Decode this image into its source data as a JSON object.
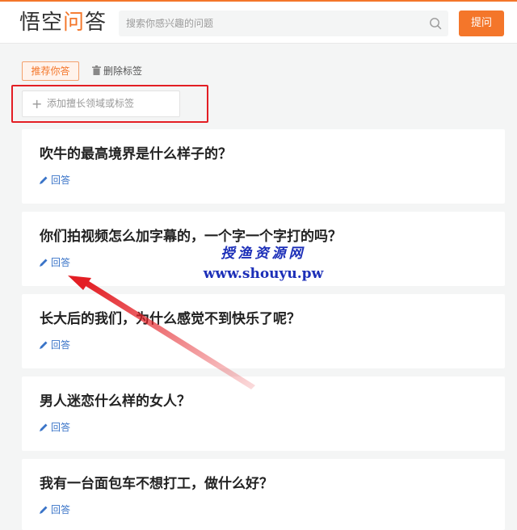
{
  "header": {
    "logo_text": "悟空",
    "logo_accent": "问",
    "logo_tail": "答",
    "search_placeholder": "搜索你感兴趣的问题",
    "search_icon": "search-icon",
    "ask_label": "提问"
  },
  "tags": {
    "recommend_label": "推荐你答",
    "delete_label": "删除标签",
    "add_placeholder": "添加擅长领域或标签",
    "add_icon": "+"
  },
  "questions": [
    {
      "title": "吹牛的最高境界是什么样子的？",
      "answer_label": "回答"
    },
    {
      "title": "你们拍视频怎么加字幕的，一个字一个字打的吗？",
      "answer_label": "回答"
    },
    {
      "title": "长大后的我们，为什么感觉不到快乐了呢？",
      "answer_label": "回答"
    },
    {
      "title": "男人迷恋什么样的女人？",
      "answer_label": "回答"
    },
    {
      "title": "我有一台面包车不想打工，做什么好？",
      "answer_label": "回答"
    }
  ],
  "watermark": {
    "cn": "授渔资源网",
    "url": "www.shouyu.pw"
  },
  "colors": {
    "accent": "#f4762a",
    "link": "#3a74c8",
    "annotation_red": "#e31e24",
    "watermark_blue": "#1c2fb8"
  }
}
